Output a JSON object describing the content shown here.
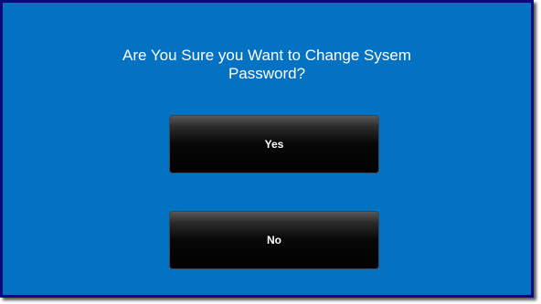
{
  "dialog": {
    "prompt_line1": "Are You Sure you Want to Change Sysem",
    "prompt_line2": "Password?",
    "yes_label": "Yes",
    "no_label": "No"
  },
  "colors": {
    "background": "#0372c3",
    "border": "#0b0a78",
    "button": "#000000",
    "text": "#ffffff"
  }
}
